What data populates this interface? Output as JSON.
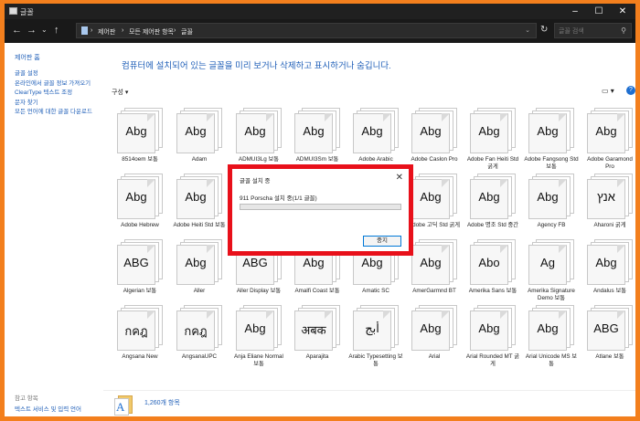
{
  "window": {
    "title": "글꼴"
  },
  "address": {
    "crumbs": [
      "제어판",
      "모든 제어판 항목",
      "글꼴"
    ],
    "search_placeholder": "글꼴 검색"
  },
  "sidebar": {
    "home": "제어판 홈",
    "links": [
      "글꼴 설정",
      "온라인에서 글꼴 정보 가져오기",
      "ClearType 텍스트 조정",
      "문자 찾기",
      "모든 언어에 대한 글꼴 다운로드"
    ],
    "see_also_title": "참고 항목",
    "see_also_link": "텍스트 서비스 및 입력 언어"
  },
  "main": {
    "heading": "컴퓨터에 설치되어 있는 글꼴을 미리 보거나 삭제하고 표시하거나 숨깁니다.",
    "organize": "구성 ▾",
    "view_icon": "view-options-icon",
    "help_icon": "help-icon"
  },
  "fonts": [
    {
      "sample": "Abg",
      "name": "8514oem 보통"
    },
    {
      "sample": "Abg",
      "name": "Adam"
    },
    {
      "sample": "Abg",
      "name": "ADMUI3Lg 보통"
    },
    {
      "sample": "Abg",
      "name": "ADMUI3Sm 보통"
    },
    {
      "sample": "Abg",
      "name": "Adobe Arabic"
    },
    {
      "sample": "Abg",
      "name": "Adobe Caslon Pro"
    },
    {
      "sample": "Abg",
      "name": "Adobe Fan Heiti Std 굵게"
    },
    {
      "sample": "Abg",
      "name": "Adobe Fangsong Std 보통"
    },
    {
      "sample": "Abg",
      "name": "Adobe Garamond Pro"
    },
    {
      "sample": "Abg",
      "name": "Adobe Hebrew"
    },
    {
      "sample": "Abg",
      "name": "Adobe Heiti Std 보통"
    },
    {
      "sample": "",
      "name": ""
    },
    {
      "sample": "",
      "name": ""
    },
    {
      "sample": "",
      "name": ""
    },
    {
      "sample": "Abg",
      "name": "Adobe 고딕 Std 굵게"
    },
    {
      "sample": "Abg",
      "name": "Adobe 명조 Std 중간"
    },
    {
      "sample": "Abg",
      "name": "Agency FB"
    },
    {
      "sample": "אנץ",
      "name": "Aharoni 굵게"
    },
    {
      "sample": "ABG",
      "name": "Algerian 보통"
    },
    {
      "sample": "Abg",
      "name": "Aller"
    },
    {
      "sample": "ABG",
      "name": "Aller Display 보통"
    },
    {
      "sample": "Abg",
      "name": "Amalfi Coast 보통"
    },
    {
      "sample": "Abg",
      "name": "Amatic SC"
    },
    {
      "sample": "Abg",
      "name": "AmerGarmnd BT"
    },
    {
      "sample": "Abo",
      "name": "Amerika Sans 보통"
    },
    {
      "sample": "Ag",
      "name": "Amerika Signature Demo 보통"
    },
    {
      "sample": "Abg",
      "name": "Andalus 보통"
    },
    {
      "sample": "กคฎ",
      "name": "Angsana New"
    },
    {
      "sample": "กคฎ",
      "name": "AngsanaUPC"
    },
    {
      "sample": "Abg",
      "name": "Anja Eliane Normal 보통"
    },
    {
      "sample": "अबक",
      "name": "Aparajita"
    },
    {
      "sample": "أبج",
      "name": "Arabic Typesetting 보통"
    },
    {
      "sample": "Abg",
      "name": "Arial"
    },
    {
      "sample": "Abg",
      "name": "Arial Rounded MT 굵게"
    },
    {
      "sample": "Abg",
      "name": "Arial Unicode MS 보통"
    },
    {
      "sample": "ABG",
      "name": "Atlane 보통"
    }
  ],
  "status": {
    "count": "1,260개 항목"
  },
  "dialog": {
    "title": "글꼴 설치 중",
    "message": "911 Porscha 설치 중(1/1 글꼴)",
    "progress": 0,
    "stop_button": "중지"
  },
  "colors": {
    "accent": "#1f5fb8",
    "highlight": "#e8101a",
    "background": "#f37f1d"
  }
}
